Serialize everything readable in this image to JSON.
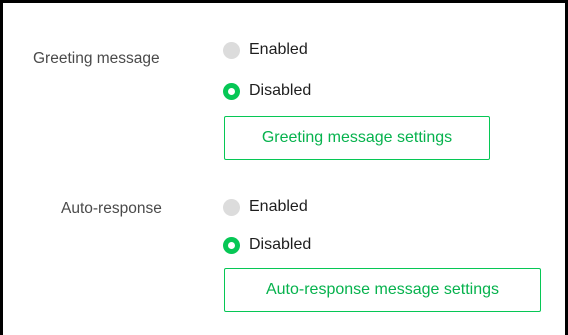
{
  "greeting": {
    "label": "Greeting message",
    "options": [
      {
        "label": "Enabled",
        "selected": false
      },
      {
        "label": "Disabled",
        "selected": true
      }
    ],
    "settings_button": "Greeting message settings"
  },
  "auto_response": {
    "label": "Auto-response",
    "options": [
      {
        "label": "Enabled",
        "selected": false
      },
      {
        "label": "Disabled",
        "selected": true
      }
    ],
    "settings_button": "Auto-response message settings"
  },
  "colors": {
    "accent": "#06c755",
    "radio_off": "#dcdcdc",
    "label_text": "#4a4a4a",
    "frame_border": "#000000"
  },
  "icons": {
    "unselected": "radio-unselected-icon",
    "selected": "radio-selected-icon"
  }
}
